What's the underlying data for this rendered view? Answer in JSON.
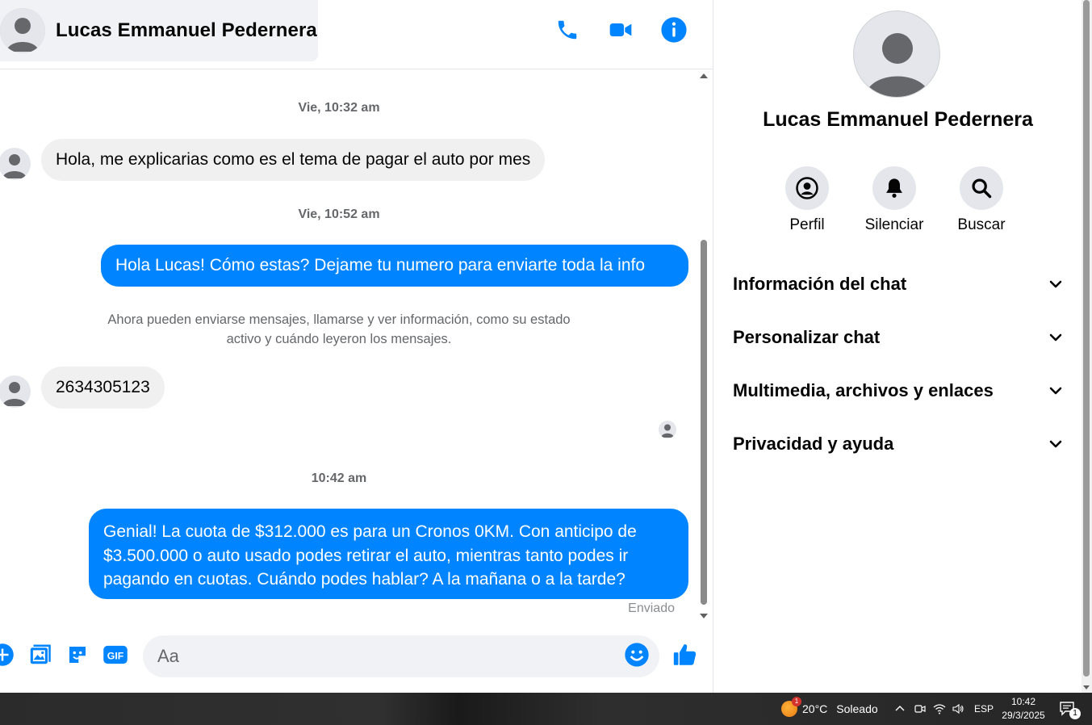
{
  "header": {
    "contact_name": "Lucas Emmanuel Pedernera",
    "icons": [
      "phone-icon",
      "video-camera-icon",
      "info-icon"
    ],
    "accent_color": "#0084ff"
  },
  "messages": [
    {
      "type": "timestamp",
      "text": "Vie, 10:32 am"
    },
    {
      "type": "incoming",
      "text": "Hola, me explicarias como es el tema de pagar el auto por mes"
    },
    {
      "type": "timestamp",
      "text": "Vie, 10:52 am"
    },
    {
      "type": "outgoing",
      "text": "Hola Lucas! Cómo estas? Dejame tu numero para enviarte toda la info"
    },
    {
      "type": "notice",
      "line1": "Ahora pueden enviarse mensajes, llamarse y ver información, como su estado",
      "line2": "activo y cuándo leyeron los mensajes."
    },
    {
      "type": "incoming",
      "text": "2634305123"
    },
    {
      "type": "timestamp",
      "text": "10:42 am"
    },
    {
      "type": "outgoing",
      "lines": [
        "Genial! La cuota de $312.000 es para un Cronos 0KM. Con anticipo de",
        "$3.500.000 o auto usado podes retirar el auto, mientras tanto podes ir",
        "pagando en cuotas. Cuándo podes hablar? A la mañana o a la tarde?"
      ]
    }
  ],
  "status": {
    "sent": "Enviado"
  },
  "composer": {
    "placeholder": "Aa",
    "icons": [
      "plus-icon",
      "image-icon",
      "sticker-icon",
      "gif-icon",
      "emoji-icon",
      "thumbs-up-icon"
    ]
  },
  "panel": {
    "name": "Lucas Emmanuel Pedernera",
    "actions": [
      {
        "label": "Perfil",
        "icon": "profile-icon"
      },
      {
        "label": "Silenciar",
        "icon": "bell-icon"
      },
      {
        "label": "Buscar",
        "icon": "search-icon"
      }
    ],
    "sections": [
      {
        "title": "Información del chat"
      },
      {
        "title": "Personalizar chat"
      },
      {
        "title": "Multimedia, archivos y enlaces"
      },
      {
        "title": "Privacidad y ayuda"
      }
    ]
  },
  "taskbar": {
    "weather_badge": "1",
    "weather": "20°C",
    "weather_desc": "Soleado",
    "language": "ESP",
    "time": "10:42",
    "date": "29/3/2025",
    "notification_count": "1"
  }
}
